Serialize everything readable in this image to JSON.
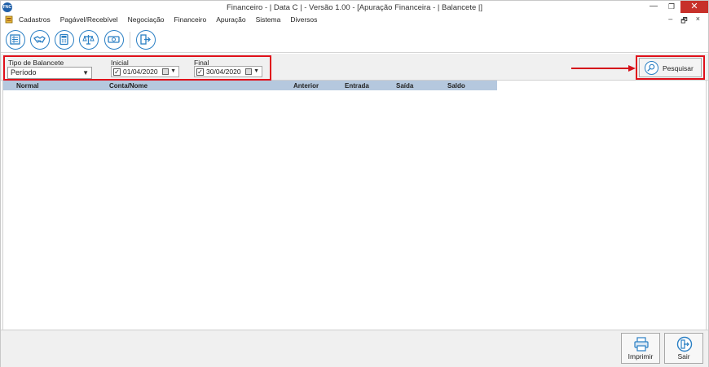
{
  "window": {
    "app_icon_text": "FNC",
    "title": "Financeiro - | Data C | - Versão 1.00 - [Apuração Financeira - | Balancete |]",
    "minimize": "—",
    "maximize": "❐",
    "close": "✕"
  },
  "menu": {
    "items": [
      "Cadastros",
      "Pagável/Recebível",
      "Negociação",
      "Financeiro",
      "Apuração",
      "Sistema",
      "Diversos"
    ],
    "mdi_minimize": "–",
    "mdi_restore": "🗗",
    "mdi_close": "×"
  },
  "toolbar": {
    "icons": [
      "list-icon",
      "handshake-icon",
      "calculator-icon",
      "scale-icon",
      "money-icon",
      "exit-icon"
    ]
  },
  "filters": {
    "tipo_label": "Tipo de Balancete",
    "tipo_value": "Período",
    "inicial_label": "Inicial",
    "inicial_value": "01/04/2020",
    "inicial_checked": "✓",
    "final_label": "Final",
    "final_value": "30/04/2020",
    "final_checked": "✓"
  },
  "search": {
    "label": "Pesquisar"
  },
  "grid": {
    "columns": [
      "Normal",
      "Conta/Nome",
      "Anterior",
      "Entrada",
      "Saída",
      "Saldo"
    ]
  },
  "footer": {
    "print_label": "Imprimir",
    "exit_label": "Sair"
  },
  "colors": {
    "accent": "#2a7fc4",
    "highlight": "#e0101a",
    "grid_header": "#b5c8de",
    "close_button": "#c7302a"
  }
}
